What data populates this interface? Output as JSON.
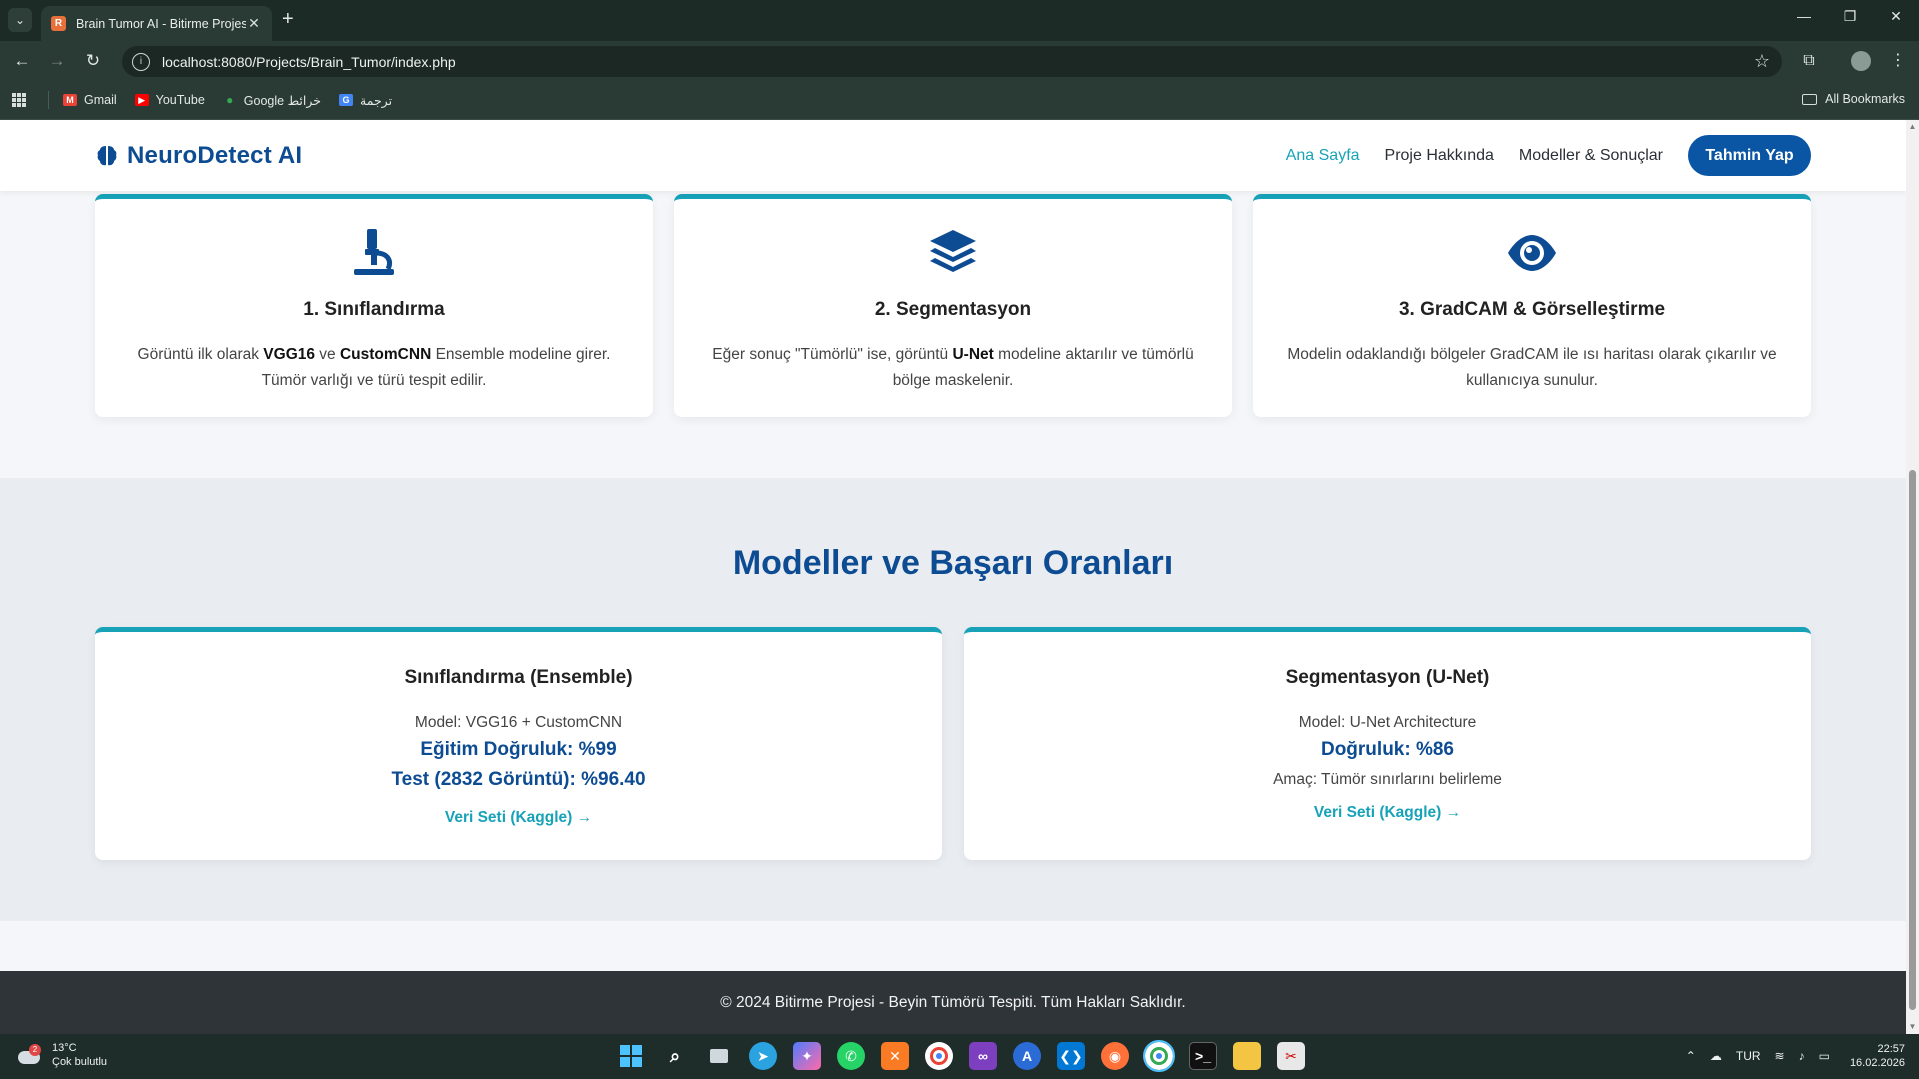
{
  "browser": {
    "tab_title": "Brain Tumor AI - Bitirme Projesi",
    "tab_favicon_text": "R",
    "url": "localhost:8080/Projects/Brain_Tumor/index.php",
    "bookmarks": [
      {
        "label": "Gmail",
        "icon": "gmail-icon",
        "color": "#ea4335"
      },
      {
        "label": "YouTube",
        "icon": "youtube-icon",
        "color": "#ff0000"
      },
      {
        "label": "Google خرائط",
        "icon": "maps-pin-icon",
        "color": "#34a853"
      },
      {
        "label": "ترجمة",
        "icon": "translate-icon",
        "color": "#4285f4"
      }
    ],
    "all_bookmarks": "All Bookmarks"
  },
  "site": {
    "brand": "NeuroDetect AI",
    "nav": {
      "home": "Ana Sayfa",
      "about": "Proje Hakkında",
      "models": "Modeller & Sonuçlar",
      "cta": "Tahmin Yap"
    },
    "steps": [
      {
        "icon": "microscope-icon",
        "title": "1. Sınıflandırma",
        "desc_1": "Görüntü ilk olarak ",
        "bold_1": "VGG16",
        "desc_2": " ve ",
        "bold_2": "CustomCNN",
        "desc_3": " Ensemble modeline girer. Tümör varlığı ve türü tespit edilir."
      },
      {
        "icon": "layers-icon",
        "title": "2. Segmentasyon",
        "desc_1": "Eğer sonuç \"Tümörlü\" ise, görüntü ",
        "bold_1": "U-Net",
        "desc_2": " modeline aktarılır ve tümörlü bölge maskelenir."
      },
      {
        "icon": "eye-icon",
        "title": "3. GradCAM & Görselleştirme",
        "desc_1": "Modelin odaklandığı bölgeler GradCAM ile ısı haritası olarak çıkarılır ve kullanıcıya sunulur."
      }
    ],
    "models_title": "Modeller ve Başarı Oranları",
    "model_cards": [
      {
        "title": "Sınıflandırma (Ensemble)",
        "model": "Model: VGG16 + CustomCNN",
        "metric_1": "Eğitim Doğruluk: %99",
        "metric_2": "Test (2832 Görüntü): %96.40",
        "link": "Veri Seti (Kaggle) →"
      },
      {
        "title": "Segmentasyon (U-Net)",
        "model": "Model: U-Net Architecture",
        "metric_1": "Doğruluk: %86",
        "purpose": "Amaç: Tümör sınırlarını belirleme",
        "link": "Veri Seti (Kaggle) →"
      }
    ],
    "footer": "© 2024 Bitirme Projesi - Beyin Tümörü Tespiti. Tüm Hakları Saklıdır."
  },
  "taskbar": {
    "weather_temp": "13°C",
    "weather_desc": "Çok bulutlu",
    "weather_badge": "2",
    "language": "TUR",
    "time": "22:57",
    "date": "16.02.2026"
  },
  "colors": {
    "brand": "#0d4c92",
    "accent": "#17a2b8",
    "cta": "#0b56a4",
    "footer_bg": "#2f3438"
  }
}
